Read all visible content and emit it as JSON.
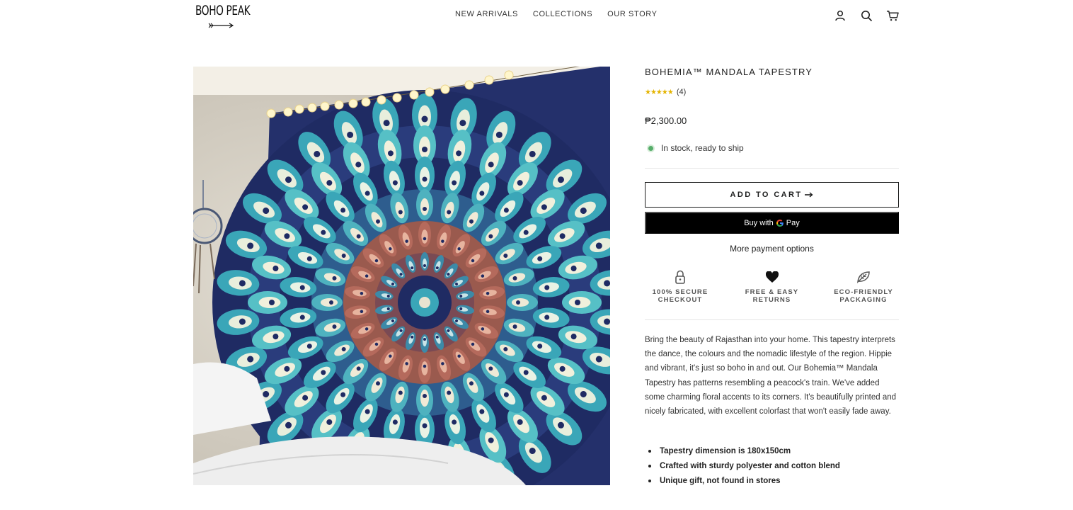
{
  "header": {
    "logo_text": "BOHO PEAK",
    "nav": [
      "NEW ARRIVALS",
      "COLLECTIONS",
      "OUR STORY"
    ],
    "icons": [
      "account-icon",
      "search-icon",
      "cart-icon"
    ]
  },
  "product": {
    "title": "BOHEMIA™ MANDALA TAPESTRY",
    "stars": "★★★★★",
    "rating": 5,
    "review_count": "(4)",
    "price": "₱2,300.00",
    "stock_text": "In stock, ready to ship",
    "add_to_cart_label": "ADD TO CART",
    "buy_with_label": "Buy with",
    "gpay_label": "Pay",
    "more_payment_label": "More payment options",
    "badges": [
      {
        "icon": "lock-icon",
        "label": "100% SECURE\nCHECKOUT"
      },
      {
        "icon": "heart-icon",
        "label": "FREE & EASY\nRETURNS"
      },
      {
        "icon": "leaf-icon",
        "label": "ECO-FRIENDLY\nPACKAGING"
      }
    ],
    "description": "Bring the beauty of Rajasthan into your home. This tapestry interprets the dance, the colours and the nomadic lifestyle of the region. Hippie and vibrant, it's just so boho in and out. Our Bohemia™ Mandala Tapestry has patterns resembling a peacock's train. We've added some charming floral accents to its corners. It's beautifully printed and nicely fabricated, with excellent colorfast that won't easily fade away.",
    "features": [
      "Tapestry dimension is 180x150cm",
      "Crafted with sturdy polyester and cotton blend",
      "Unique gift, not found in stores"
    ]
  },
  "colors": {
    "text": "#1c1d1d",
    "stock_dot": "#56ad6a",
    "star": "#e4b400",
    "tapestry_navy": "#1f2b63",
    "tapestry_teal": "#3aa6b8",
    "tapestry_rust": "#9a5a4e"
  }
}
